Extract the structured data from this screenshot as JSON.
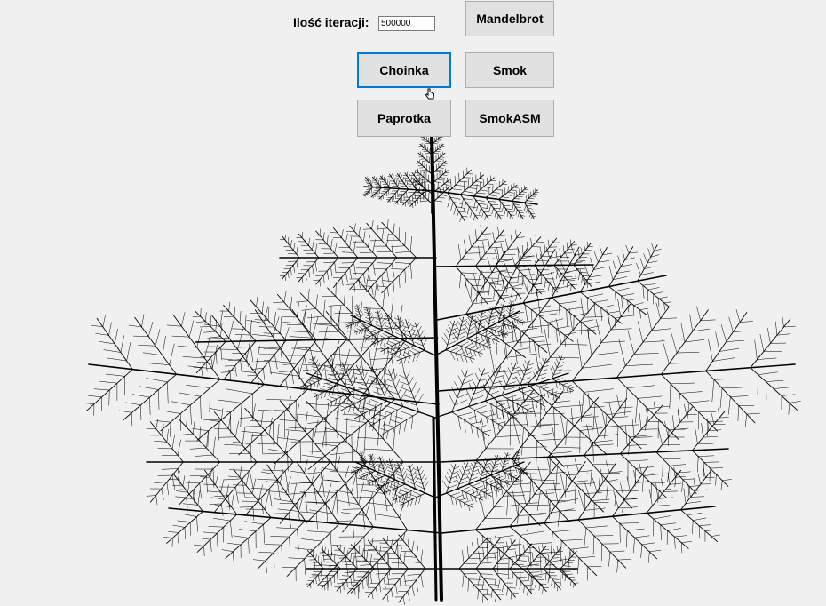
{
  "controls": {
    "iterations_label": "Ilość iteracji:",
    "iterations_value": "500000"
  },
  "buttons": {
    "mandelbrot": "Mandelbrot",
    "choinka": "Choinka",
    "smok": "Smok",
    "paprotka": "Paprotka",
    "smokasm": "SmokASM"
  },
  "canvas": {
    "fractal": "choinka",
    "iterations": 500000,
    "color": "#000000",
    "background": "#f0f0f0"
  },
  "colors": {
    "focus_border": "#0078d7",
    "button_bg": "#e1e1e1"
  },
  "icons": {
    "cursor": "hand-pointer-icon"
  }
}
